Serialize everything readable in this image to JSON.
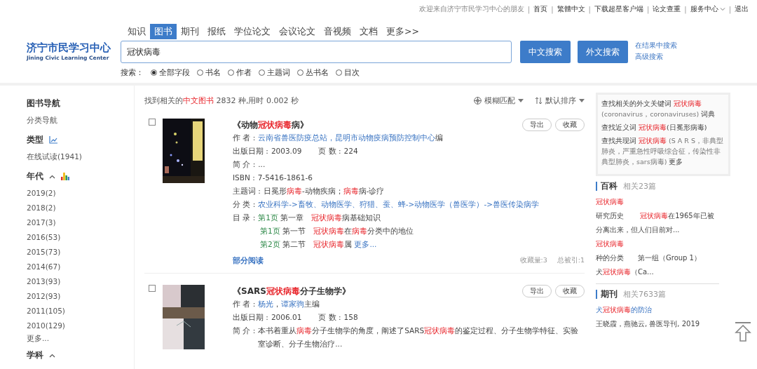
{
  "top_bar": {
    "greeting": "欢迎来自济宁市民学习中心的朋友",
    "separator": "|",
    "links": [
      {
        "label": "首页",
        "kind": "link"
      },
      {
        "label": "繁體中文",
        "kind": "link"
      },
      {
        "label": "下载超星客户端",
        "kind": "link"
      },
      {
        "label": "论文查重",
        "kind": "link"
      },
      {
        "label": "服务中心",
        "kind": "dropdown"
      },
      {
        "label": "退出",
        "kind": "link"
      }
    ]
  },
  "logo": {
    "name": "济宁市民学习中心",
    "subtitle": "Jining Civic Learning Center"
  },
  "tabs": [
    {
      "label": "知识",
      "selected": false
    },
    {
      "label": "图书",
      "selected": true
    },
    {
      "label": "期刊",
      "selected": false
    },
    {
      "label": "报纸",
      "selected": false
    },
    {
      "label": "学位论文",
      "selected": false
    },
    {
      "label": "会议论文",
      "selected": false
    },
    {
      "label": "音视频",
      "selected": false
    },
    {
      "label": "文档",
      "selected": false
    },
    {
      "label": "更多>>",
      "selected": false
    }
  ],
  "search": {
    "value": "冠状病毒"
  },
  "buttons": [
    "中文搜索",
    "外文搜索"
  ],
  "search_links": [
    "在结果中搜索",
    "高级搜索"
  ],
  "fields": {
    "label": "搜索：",
    "options": [
      {
        "label": "全部字段",
        "selected": true
      },
      {
        "label": "书名",
        "selected": false
      },
      {
        "label": "作者",
        "selected": false
      },
      {
        "label": "主题词",
        "selected": false
      },
      {
        "label": "丛书名",
        "selected": false
      },
      {
        "label": "目次",
        "selected": false
      }
    ]
  },
  "sidebar": [
    {
      "title": "图书导航",
      "kind": "plain",
      "items": [
        "分类导航"
      ]
    },
    {
      "title": "类型",
      "kind": "trend",
      "items": [
        "在线试读(1941)"
      ]
    },
    {
      "title": "年代",
      "kind": "stats",
      "expanded": true,
      "items": [
        "2019(2)",
        "2018(2)",
        "2017(3)",
        "2016(53)",
        "2015(73)",
        "2014(67)",
        "2013(93)",
        "2012(93)",
        "2011(105)",
        "2010(129)"
      ],
      "more": "更多..."
    },
    {
      "title": "学科",
      "kind": "plain",
      "expanded": true
    }
  ],
  "results": {
    "summary": [
      {
        "t": "找到相关的"
      },
      {
        "t": "中文图书",
        "kind": "hl"
      },
      {
        "t": " 2832 种,用时 0.002 秒"
      }
    ],
    "filters": [
      {
        "label": "模糊匹配",
        "kind": "match"
      },
      {
        "label": "默认排序",
        "kind": "sort"
      }
    ],
    "books": [
      {
        "checked": false,
        "title": [
          {
            "t": "《动物"
          },
          {
            "t": "冠状病毒",
            "kind": "hl"
          },
          {
            "t": "病》"
          }
        ],
        "actions": [
          "导出",
          "收藏"
        ],
        "lines": [
          {
            "items": [
              {
                "label": "作 者 :",
                "value": [
                  {
                    "t": "云南省兽医防疫总站，昆明市动物疫病预防控制中心",
                    "kind": "link"
                  },
                  {
                    "t": "编"
                  }
                ]
              }
            ]
          },
          {
            "items": [
              {
                "label": "出版日期 :",
                "value": [
                  {
                    "t": "2003.09"
                  }
                ]
              },
              {
                "label": "页 数 :",
                "value": [
                  {
                    "t": "224"
                  }
                ]
              }
            ]
          },
          {
            "items": [
              {
                "label": "简 介 :",
                "value": [
                  {
                    "t": "..."
                  }
                ]
              }
            ]
          },
          {
            "items": [
              {
                "label": "ISBN :",
                "value": [
                  {
                    "t": "7-5416-1861-6"
                  }
                ]
              }
            ]
          },
          {
            "items": [
              {
                "label": "主题词 :",
                "value": [
                  {
                    "t": "日冕形"
                  },
                  {
                    "t": "病毒",
                    "kind": "hl"
                  },
                  {
                    "t": "-动物疾病；"
                  },
                  {
                    "t": "病毒",
                    "kind": "hl"
                  },
                  {
                    "t": "病-诊疗"
                  }
                ]
              }
            ]
          },
          {
            "items": [
              {
                "label": "分 类 :",
                "value": [
                  {
                    "t": "农业科学->畜牧、动物医学、狩猎、蚕、蜂->动物医学（兽医学）->兽医传染病学",
                    "kind": "link"
                  }
                ]
              }
            ]
          },
          {
            "items": [
              {
                "label": "目 录 :",
                "value": [
                  {
                    "t": "第1页",
                    "kind": "green"
                  },
                  {
                    "t": " 第一章　"
                  },
                  {
                    "t": "冠状病毒",
                    "kind": "hl"
                  },
                  {
                    "t": "病基础知识"
                  }
                ]
              }
            ]
          },
          {
            "items": [
              {
                "value": [
                  {
                    "t": "第1页",
                    "kind": "green"
                  },
                  {
                    "t": " 第一节　"
                  },
                  {
                    "t": "冠状病毒",
                    "kind": "hl"
                  },
                  {
                    "t": "在"
                  },
                  {
                    "t": "病毒",
                    "kind": "hl"
                  },
                  {
                    "t": "分类中的地位"
                  }
                ]
              }
            ]
          },
          {
            "items": [
              {
                "value": [
                  {
                    "t": "第2页",
                    "kind": "green"
                  },
                  {
                    "t": " 第二节　"
                  },
                  {
                    "t": "冠状病毒",
                    "kind": "hl"
                  },
                  {
                    "t": "属 "
                  },
                  {
                    "t": "更多...",
                    "kind": "link"
                  }
                ]
              }
            ]
          }
        ],
        "read_link": "部分阅读",
        "stats": [
          "收藏量:3",
          "总被引:1"
        ]
      },
      {
        "checked": false,
        "title": [
          {
            "t": "《SARS"
          },
          {
            "t": "冠状病毒",
            "kind": "hl"
          },
          {
            "t": "分子生物学》"
          }
        ],
        "actions": [
          "导出",
          "收藏"
        ],
        "lines": [
          {
            "items": [
              {
                "label": "作 者 :",
                "value": [
                  {
                    "t": "杨光",
                    "kind": "link"
                  },
                  {
                    "t": "，"
                  },
                  {
                    "t": "谭家驹",
                    "kind": "link"
                  },
                  {
                    "t": "主编"
                  }
                ]
              }
            ]
          },
          {
            "items": [
              {
                "label": "出版日期 :",
                "value": [
                  {
                    "t": "2006.01"
                  }
                ]
              },
              {
                "label": "页 数 :",
                "value": [
                  {
                    "t": "158"
                  }
                ]
              }
            ]
          },
          {
            "items": [
              {
                "label": "简 介 :",
                "value": [
                  {
                    "t": "本书着重从"
                  },
                  {
                    "t": "病毒",
                    "kind": "hl"
                  },
                  {
                    "t": "分子生物学的角度，阐述了SARS"
                  },
                  {
                    "t": "冠状病毒",
                    "kind": "hl"
                  },
                  {
                    "t": "的鉴定过程、分子生物学特征、实验室诊断、分子生物治疗..."
                  }
                ]
              }
            ]
          }
        ]
      }
    ]
  },
  "related": {
    "lines": [
      [
        {
          "t": "查找相关的外文关键词 "
        },
        {
          "t": "冠状病毒",
          "kind": "hl"
        },
        {
          "t": " (coronavirus，coronaviruses) ",
          "kind": "muted"
        },
        {
          "t": "词典"
        }
      ],
      [
        {
          "t": "查找近义词 "
        },
        {
          "t": "冠状病毒",
          "kind": "hl"
        },
        {
          "t": "(日冕形病毒)"
        }
      ],
      [
        {
          "t": "查找共现词 "
        },
        {
          "t": "冠状病毒",
          "kind": "hl"
        },
        {
          "t": " (S A R S，非典型肺炎，严重急性呼吸综合征，传染性非典型肺炎，sars病毒) ",
          "kind": "muted"
        },
        {
          "t": "更多"
        }
      ]
    ]
  },
  "panels": [
    {
      "title": "百科",
      "count": "相关23篇",
      "entries": [
        [
          {
            "t": "冠状病毒",
            "kind": "hl"
          }
        ],
        [
          {
            "t": "研究历史　　 "
          },
          {
            "t": "冠状病毒",
            "kind": "hl"
          },
          {
            "t": "在1965年已被分离出来，但人们目前对..."
          }
        ],
        [
          {
            "t": "冠状病毒",
            "kind": "hl"
          }
        ],
        [
          {
            "t": "种的分类　　第一组（Group 1）"
          }
        ],
        [
          {
            "t": "犬"
          },
          {
            "t": "冠状病毒",
            "kind": "hl"
          },
          {
            "t": "（Ca..."
          }
        ]
      ]
    },
    {
      "title": "期刊",
      "count": "相关7633篇",
      "entries": [
        [
          {
            "t": "犬",
            "kind": "link"
          },
          {
            "t": "冠状病毒",
            "kind": "hl"
          },
          {
            "t": "的防治",
            "kind": "link"
          }
        ],
        [
          {
            "t": "王晓霞，燕驰云, 兽医导刊, 2019"
          }
        ]
      ]
    }
  ]
}
